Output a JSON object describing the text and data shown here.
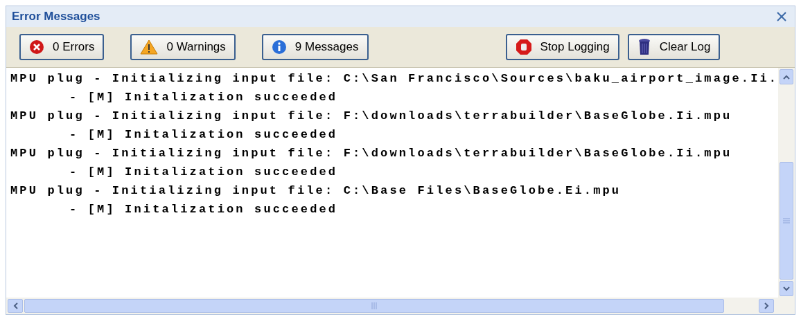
{
  "panel": {
    "title": "Error Messages"
  },
  "toolbar": {
    "filters": [
      {
        "kind": "error",
        "label": "0 Errors"
      },
      {
        "kind": "warning",
        "label": "0 Warnings"
      },
      {
        "kind": "info",
        "label": "9 Messages"
      }
    ],
    "actions": [
      {
        "kind": "stop",
        "label": "Stop Logging"
      },
      {
        "kind": "clear",
        "label": "Clear Log"
      }
    ]
  },
  "log": [
    {
      "kind": "entry",
      "text": "MPU plug - Initializing input file: C:\\San Francisco\\Sources\\baku_airport_image.Ii."
    },
    {
      "kind": "detail",
      "text": "- [M] Initalization succeeded"
    },
    {
      "kind": "entry",
      "text": "MPU plug - Initializing input file: F:\\downloads\\terrabuilder\\BaseGlobe.Ii.mpu"
    },
    {
      "kind": "detail",
      "text": "- [M] Initalization succeeded"
    },
    {
      "kind": "entry",
      "text": "MPU plug - Initializing input file: F:\\downloads\\terrabuilder\\BaseGlobe.Ii.mpu"
    },
    {
      "kind": "detail",
      "text": "- [M] Initalization succeeded"
    },
    {
      "kind": "entry",
      "text": "MPU plug - Initializing input file: C:\\Base Files\\BaseGlobe.Ei.mpu"
    },
    {
      "kind": "detail",
      "text": "- [M] Initalization succeeded"
    }
  ]
}
